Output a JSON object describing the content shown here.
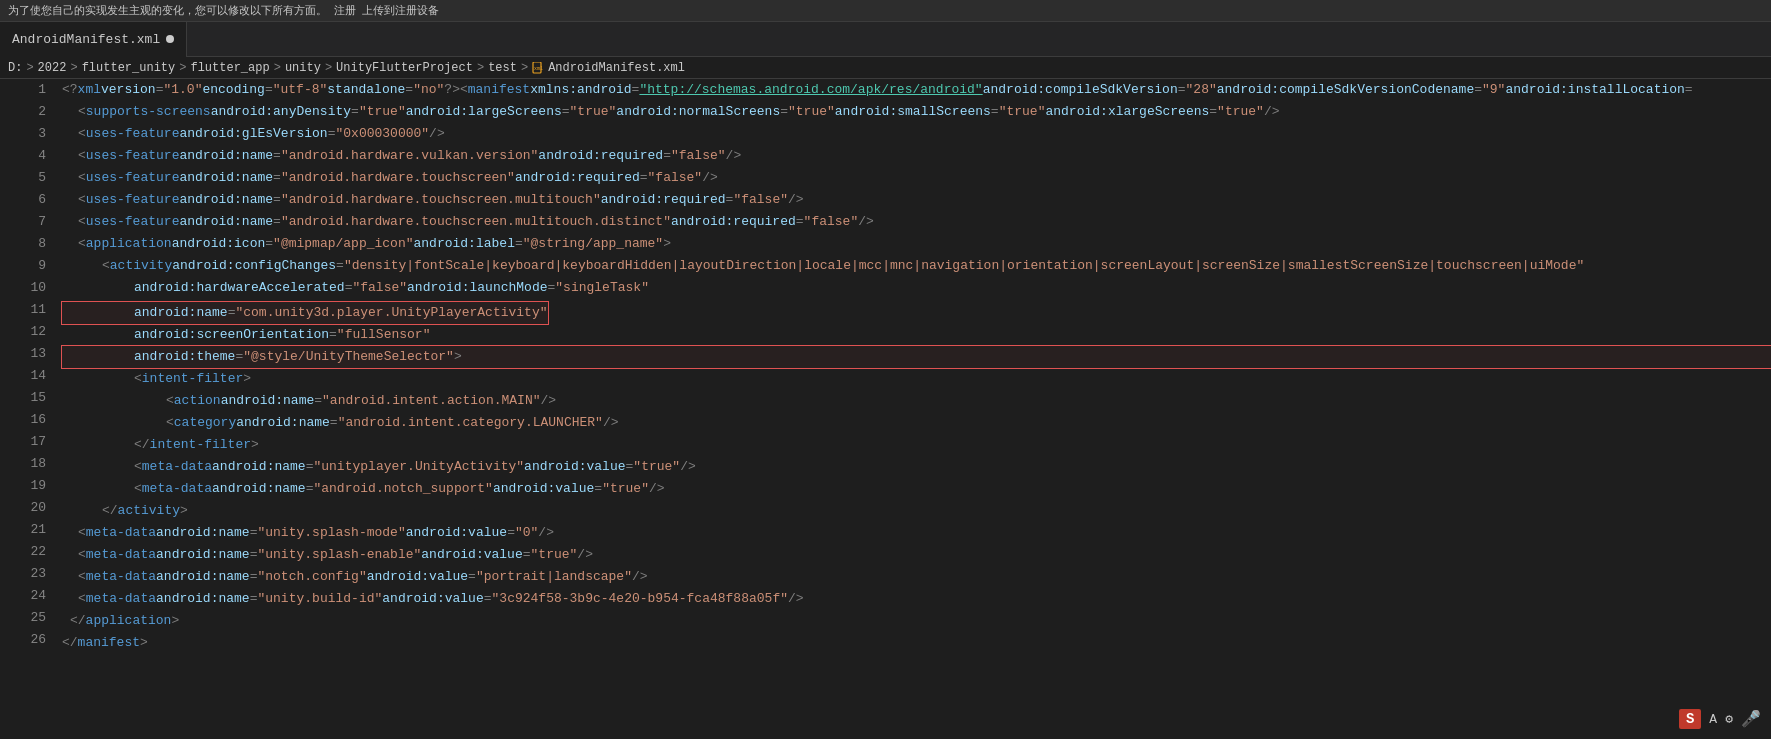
{
  "topbar": {
    "text": "为了使您自己的实现发生主观的变化，您可以修改以下所有方面。 注册  上传到注册设备"
  },
  "tab": {
    "filename": "AndroidManifest.xml",
    "modified": true
  },
  "breadcrumb": {
    "parts": [
      "D:",
      "2022",
      "flutter_unity",
      "flutter_app",
      "unity",
      "UnityFlutterProject",
      "test",
      "AndroidManifest.xml"
    ]
  },
  "lines": [
    {
      "num": 1,
      "content": "<?xml version=\"1.0\" encoding=\"utf-8\" standalone=\"no\"?><manifest xmlns:android=\"http://schemas.android.com/apk/res/android\" android:compileSdkVersion=\"28\" android:compileSdkVersionCodename=\"9\" android:installLocation="
    },
    {
      "num": 2,
      "content": "    <supports-screens android:anyDensity=\"true\" android:largeScreens=\"true\" android:normalScreens=\"true\" android:smallScreens=\"true\" android:xlargeScreens=\"true\"/>"
    },
    {
      "num": 3,
      "content": "    <uses-feature android:glEsVersion=\"0x00030000\"/>"
    },
    {
      "num": 4,
      "content": "    <uses-feature android:name=\"android.hardware.vulkan.version\" android:required=\"false\"/>"
    },
    {
      "num": 5,
      "content": "    <uses-feature android:name=\"android.hardware.touchscreen\" android:required=\"false\"/>"
    },
    {
      "num": 6,
      "content": "    <uses-feature android:name=\"android.hardware.touchscreen.multitouch\" android:required=\"false\"/>"
    },
    {
      "num": 7,
      "content": "    <uses-feature android:name=\"android.hardware.touchscreen.multitouch.distinct\" android:required=\"false\"/>"
    },
    {
      "num": 8,
      "content": "    <application android:icon=\"@mipmap/app_icon\" android:label=\"@string/app_name\">"
    },
    {
      "num": 9,
      "content": "        <activity android:configChanges=\"density|fontScale|keyboard|keyboardHidden|layoutDirection|locale|mcc|mnc|navigation|orientation|screenLayout|screenSize|smallestScreenSize|touchscreen|uiMode\""
    },
    {
      "num": 10,
      "content": "            android:hardwareAccelerated=\"false\" android:launchMode=\"singleTask\""
    },
    {
      "num": 11,
      "content": "            android:name=\"com.unity3d.player.UnityPlayerActivity\"",
      "highlight": true
    },
    {
      "num": 12,
      "content": "            android:screenOrientation=\"fullSensor\""
    },
    {
      "num": 13,
      "content": "            android:theme=\"@style/UnityThemeSelector\">",
      "highlight": true
    },
    {
      "num": 14,
      "content": "            <intent-filter>"
    },
    {
      "num": 15,
      "content": "                <action android:name=\"android.intent.action.MAIN\"/>"
    },
    {
      "num": 16,
      "content": "                <category android:name=\"android.intent.category.LAUNCHER\"/>"
    },
    {
      "num": 17,
      "content": "            </intent-filter>"
    },
    {
      "num": 18,
      "content": "            <meta-data android:name=\"unityplayer.UnityActivity\" android:value=\"true\"/>"
    },
    {
      "num": 19,
      "content": "            <meta-data android:name=\"android.notch_support\" android:value=\"true\"/>"
    },
    {
      "num": 20,
      "content": "        </activity>"
    },
    {
      "num": 21,
      "content": "        <meta-data android:name=\"unity.splash-mode\" android:value=\"0\"/>"
    },
    {
      "num": 22,
      "content": "        <meta-data android:name=\"unity.splash-enable\" android:value=\"true\"/>"
    },
    {
      "num": 23,
      "content": "        <meta-data android:name=\"notch.config\" android:value=\"portrait|landscape\"/>"
    },
    {
      "num": 24,
      "content": "        <meta-data android:name=\"unity.build-id\" android:value=\"3c924f58-3b9c-4e20-b954-fca48f88a05f\"/>"
    },
    {
      "num": 25,
      "content": "    </application>"
    },
    {
      "num": 26,
      "content": "</manifest>"
    }
  ],
  "statusbar": {
    "badge": "S",
    "a_label": "A",
    "mic_icon": "🎤"
  }
}
